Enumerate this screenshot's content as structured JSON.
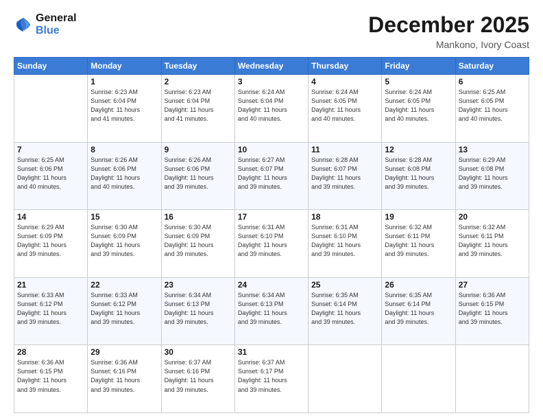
{
  "header": {
    "logo_line1": "General",
    "logo_line2": "Blue",
    "month": "December 2025",
    "location": "Mankono, Ivory Coast"
  },
  "days_of_week": [
    "Sunday",
    "Monday",
    "Tuesday",
    "Wednesday",
    "Thursday",
    "Friday",
    "Saturday"
  ],
  "weeks": [
    [
      {
        "day": "",
        "info": ""
      },
      {
        "day": "1",
        "info": "Sunrise: 6:23 AM\nSunset: 6:04 PM\nDaylight: 11 hours\nand 41 minutes."
      },
      {
        "day": "2",
        "info": "Sunrise: 6:23 AM\nSunset: 6:04 PM\nDaylight: 11 hours\nand 41 minutes."
      },
      {
        "day": "3",
        "info": "Sunrise: 6:24 AM\nSunset: 6:04 PM\nDaylight: 11 hours\nand 40 minutes."
      },
      {
        "day": "4",
        "info": "Sunrise: 6:24 AM\nSunset: 6:05 PM\nDaylight: 11 hours\nand 40 minutes."
      },
      {
        "day": "5",
        "info": "Sunrise: 6:24 AM\nSunset: 6:05 PM\nDaylight: 11 hours\nand 40 minutes."
      },
      {
        "day": "6",
        "info": "Sunrise: 6:25 AM\nSunset: 6:05 PM\nDaylight: 11 hours\nand 40 minutes."
      }
    ],
    [
      {
        "day": "7",
        "info": "Sunrise: 6:25 AM\nSunset: 6:06 PM\nDaylight: 11 hours\nand 40 minutes."
      },
      {
        "day": "8",
        "info": "Sunrise: 6:26 AM\nSunset: 6:06 PM\nDaylight: 11 hours\nand 40 minutes."
      },
      {
        "day": "9",
        "info": "Sunrise: 6:26 AM\nSunset: 6:06 PM\nDaylight: 11 hours\nand 39 minutes."
      },
      {
        "day": "10",
        "info": "Sunrise: 6:27 AM\nSunset: 6:07 PM\nDaylight: 11 hours\nand 39 minutes."
      },
      {
        "day": "11",
        "info": "Sunrise: 6:28 AM\nSunset: 6:07 PM\nDaylight: 11 hours\nand 39 minutes."
      },
      {
        "day": "12",
        "info": "Sunrise: 6:28 AM\nSunset: 6:08 PM\nDaylight: 11 hours\nand 39 minutes."
      },
      {
        "day": "13",
        "info": "Sunrise: 6:29 AM\nSunset: 6:08 PM\nDaylight: 11 hours\nand 39 minutes."
      }
    ],
    [
      {
        "day": "14",
        "info": "Sunrise: 6:29 AM\nSunset: 6:09 PM\nDaylight: 11 hours\nand 39 minutes."
      },
      {
        "day": "15",
        "info": "Sunrise: 6:30 AM\nSunset: 6:09 PM\nDaylight: 11 hours\nand 39 minutes."
      },
      {
        "day": "16",
        "info": "Sunrise: 6:30 AM\nSunset: 6:09 PM\nDaylight: 11 hours\nand 39 minutes."
      },
      {
        "day": "17",
        "info": "Sunrise: 6:31 AM\nSunset: 6:10 PM\nDaylight: 11 hours\nand 39 minutes."
      },
      {
        "day": "18",
        "info": "Sunrise: 6:31 AM\nSunset: 6:10 PM\nDaylight: 11 hours\nand 39 minutes."
      },
      {
        "day": "19",
        "info": "Sunrise: 6:32 AM\nSunset: 6:11 PM\nDaylight: 11 hours\nand 39 minutes."
      },
      {
        "day": "20",
        "info": "Sunrise: 6:32 AM\nSunset: 6:11 PM\nDaylight: 11 hours\nand 39 minutes."
      }
    ],
    [
      {
        "day": "21",
        "info": "Sunrise: 6:33 AM\nSunset: 6:12 PM\nDaylight: 11 hours\nand 39 minutes."
      },
      {
        "day": "22",
        "info": "Sunrise: 6:33 AM\nSunset: 6:12 PM\nDaylight: 11 hours\nand 39 minutes."
      },
      {
        "day": "23",
        "info": "Sunrise: 6:34 AM\nSunset: 6:13 PM\nDaylight: 11 hours\nand 39 minutes."
      },
      {
        "day": "24",
        "info": "Sunrise: 6:34 AM\nSunset: 6:13 PM\nDaylight: 11 hours\nand 39 minutes."
      },
      {
        "day": "25",
        "info": "Sunrise: 6:35 AM\nSunset: 6:14 PM\nDaylight: 11 hours\nand 39 minutes."
      },
      {
        "day": "26",
        "info": "Sunrise: 6:35 AM\nSunset: 6:14 PM\nDaylight: 11 hours\nand 39 minutes."
      },
      {
        "day": "27",
        "info": "Sunrise: 6:36 AM\nSunset: 6:15 PM\nDaylight: 11 hours\nand 39 minutes."
      }
    ],
    [
      {
        "day": "28",
        "info": "Sunrise: 6:36 AM\nSunset: 6:15 PM\nDaylight: 11 hours\nand 39 minutes."
      },
      {
        "day": "29",
        "info": "Sunrise: 6:36 AM\nSunset: 6:16 PM\nDaylight: 11 hours\nand 39 minutes."
      },
      {
        "day": "30",
        "info": "Sunrise: 6:37 AM\nSunset: 6:16 PM\nDaylight: 11 hours\nand 39 minutes."
      },
      {
        "day": "31",
        "info": "Sunrise: 6:37 AM\nSunset: 6:17 PM\nDaylight: 11 hours\nand 39 minutes."
      },
      {
        "day": "",
        "info": ""
      },
      {
        "day": "",
        "info": ""
      },
      {
        "day": "",
        "info": ""
      }
    ]
  ]
}
